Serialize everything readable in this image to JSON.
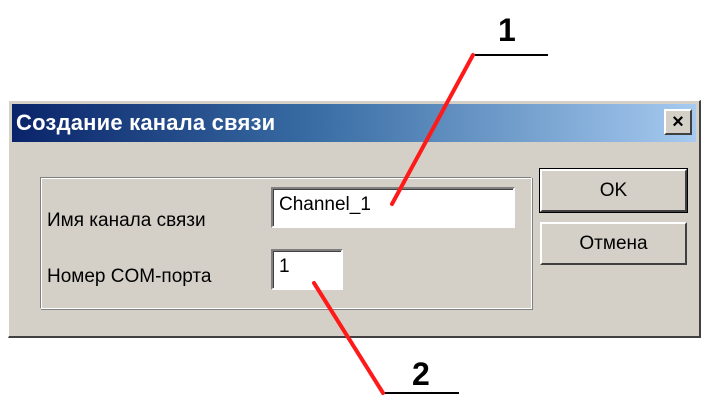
{
  "dialog": {
    "title": "Создание канала связи",
    "close_glyph": "×",
    "fields": {
      "channel_name_label": "Имя канала связи",
      "channel_name_value": "Channel_1",
      "com_port_label": "Номер COM-порта",
      "com_port_value": "1"
    },
    "buttons": {
      "ok": "OK",
      "cancel": "Отмена"
    }
  },
  "annotations": {
    "callout_1": "1",
    "callout_2": "2"
  },
  "colors": {
    "titlebar_start": "#0a246a",
    "titlebar_end": "#a6caf0",
    "dialog_face": "#d4d0c8",
    "annotation_line": "#ff0000"
  }
}
